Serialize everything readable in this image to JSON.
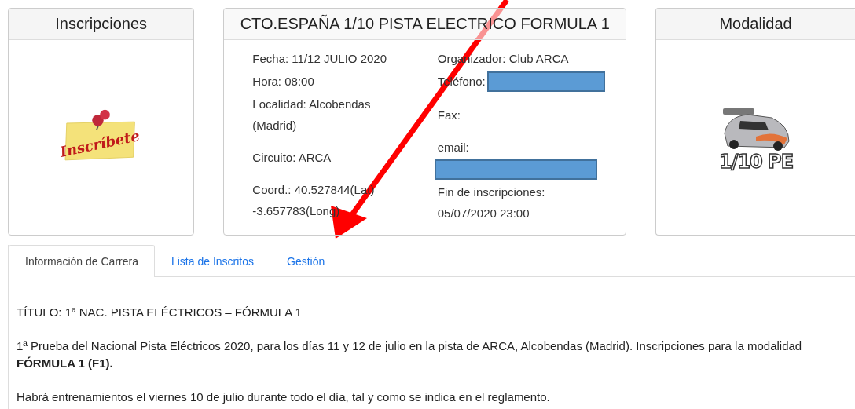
{
  "cards": [
    {
      "kind": "sticker",
      "title": "Inscripciones",
      "sticker_text": "Inscríbete"
    },
    {
      "kind": "info",
      "title": "CTO.ESPAÑA 1/10 PISTA ELECTRICO FORMULA 1",
      "left_column": [
        {
          "text": "Fecha: 11/12 JULIO 2020"
        },
        {
          "text": "Hora: 08:00"
        },
        {
          "text": "Localidad: Alcobendas (Madrid)"
        },
        {
          "text": "Circuito: ARCA"
        },
        {
          "text": "Coord.: 40.527844(Lat) -3.657783(Long)"
        }
      ],
      "right_column": [
        {
          "text": "Organizador: Club ARCA",
          "redacted": false
        },
        {
          "text": "Teléfono:",
          "redacted": true
        },
        {
          "text": "Fax:",
          "redacted": false
        },
        {
          "text": "email:",
          "redacted": true
        },
        {
          "text": "Fin de inscripciones: 05/07/2020 23:00",
          "redacted": false
        }
      ]
    },
    {
      "kind": "car",
      "title": "Modalidad",
      "car_label": "1/10 PE"
    }
  ],
  "tabs": [
    {
      "label": "Información de Carrera",
      "selected": true
    },
    {
      "label": "Lista de Inscritos",
      "selected": false
    },
    {
      "label": "Gestión",
      "selected": false
    }
  ],
  "content": [
    "TÍTULO: 1ª NAC. PISTA ELÉCTRICOS – FÓRMULA 1",
    "1ª Prueba del Nacional Pista Eléctricos 2020, para los días 11 y 12 de julio en la pista de ARCA, Alcobendas (Madrid). Inscripciones para la modalidad **FÓRMULA 1 (F1).**",
    "Habrá entrenamientos el viernes 10 de julio durante todo el día, tal y como se indica en el reglamento."
  ]
}
